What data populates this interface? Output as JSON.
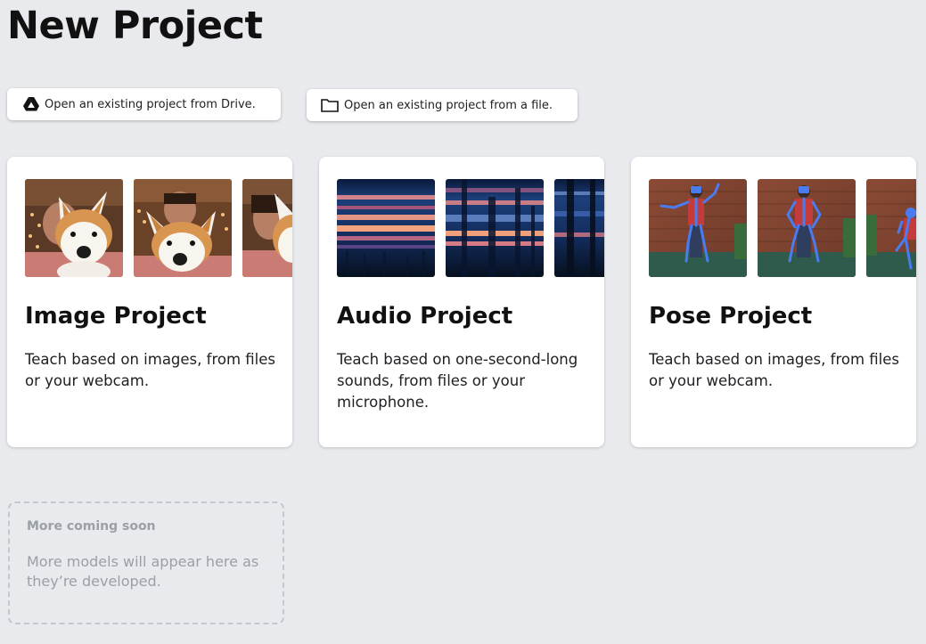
{
  "page": {
    "title": "New Project"
  },
  "open_buttons": {
    "drive": {
      "label": "Open an existing project from Drive.",
      "icon": "google-drive-icon"
    },
    "file": {
      "label": "Open an existing project from a file.",
      "icon": "folder-icon"
    }
  },
  "cards": [
    {
      "title": "Image Project",
      "description": "Teach based on images, from files or your webcam.",
      "thumbnails": [
        "person-holding-plush-dog-photo",
        "person-holding-plush-dog-photo",
        "person-holding-plush-dog-photo"
      ]
    },
    {
      "title": "Audio Project",
      "description": "Teach based on one-second-long sounds, from files or your microphone.",
      "thumbnails": [
        "spectrogram-image",
        "spectrogram-image",
        "spectrogram-image"
      ]
    },
    {
      "title": "Pose Project",
      "description": "Teach based on images, from files or your webcam.",
      "thumbnails": [
        "pose-skeleton-photo",
        "pose-skeleton-photo",
        "pose-skeleton-photo"
      ]
    }
  ],
  "coming_soon": {
    "title": "More coming soon",
    "description": "More models will appear here as they’re developed."
  },
  "colors": {
    "background": "#e8eaed",
    "card": "#ffffff",
    "muted_text": "#9aa0a6",
    "pose_skeleton": "#4a7cf0"
  }
}
